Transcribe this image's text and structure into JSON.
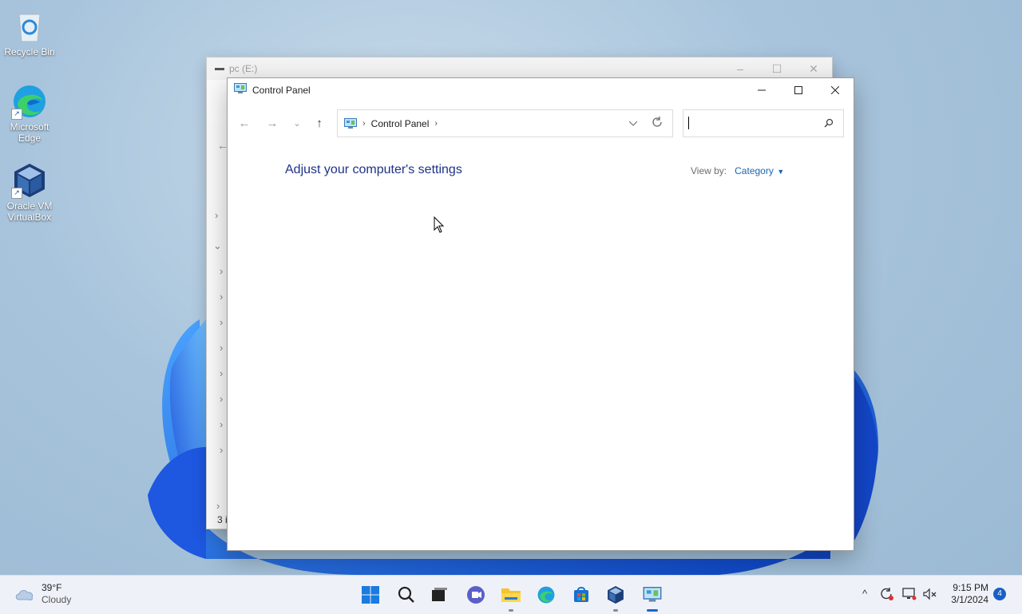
{
  "desktop": {
    "icons": [
      {
        "label": "Recycle Bin"
      },
      {
        "label": "Microsoft Edge"
      },
      {
        "label": "Oracle VM VirtualBox"
      }
    ]
  },
  "background_window": {
    "title": "pc (E:)",
    "status": "3 i"
  },
  "control_panel": {
    "title": "Control Panel",
    "address": {
      "crumb": "Control Panel"
    },
    "search_placeholder": "",
    "heading": "Adjust your computer's settings",
    "view_by_label": "View by:",
    "view_by_value": "Category"
  },
  "taskbar": {
    "weather": {
      "temp": "39°F",
      "condition": "Cloudy"
    },
    "apps": [
      "start-icon",
      "search-icon",
      "task-view-icon",
      "chat-icon",
      "file-explorer-icon",
      "edge-icon",
      "store-icon",
      "virtualbox-icon",
      "control-panel-icon"
    ],
    "clock": {
      "time": "9:15 PM",
      "date": "3/1/2024"
    },
    "notification_count": "4"
  },
  "colors": {
    "heading": "#1e3287",
    "link": "#1a66b0",
    "accent": "#1a66d2"
  }
}
